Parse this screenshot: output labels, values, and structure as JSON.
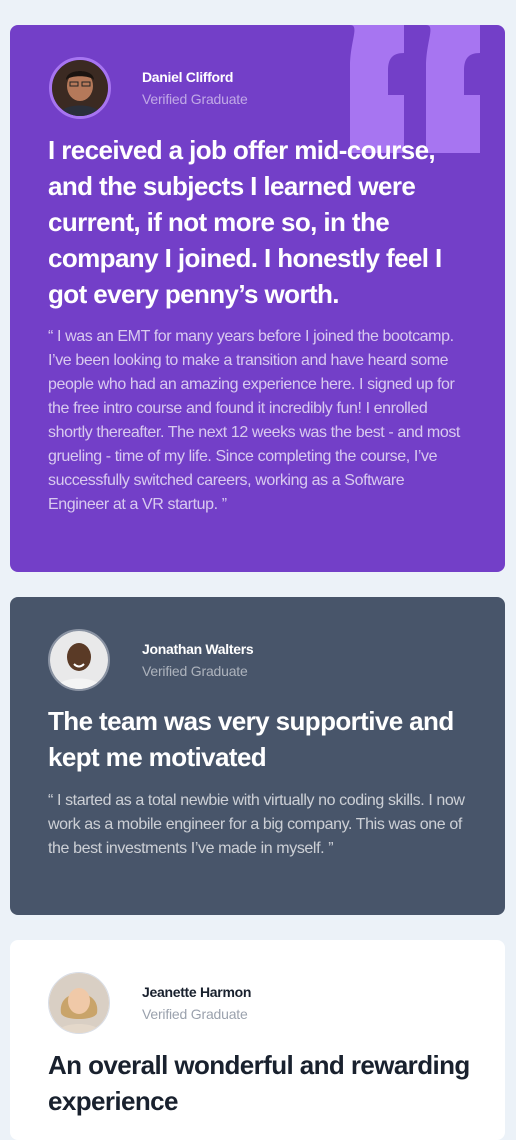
{
  "testimonials": [
    {
      "name": "Daniel Clifford",
      "role": "Verified Graduate",
      "headline": "I received a job offer mid-course, and the subjects I learned were current, if not more so, in the company I joined. I honestly feel I got every penny’s worth.",
      "body": "“ I was an EMT for many years before I joined the bootcamp. I’ve been looking to make a transition and have heard some people who had an amazing experience here. I signed up for the free intro course and found it incredibly fun! I enrolled shortly thereafter. The next 12 weeks was the best - and most grueling - time of my life. Since completing the course, I’ve successfully switched careers, working as a Software Engineer at a VR startup. ”"
    },
    {
      "name": "Jonathan Walters",
      "role": "Verified Graduate",
      "headline": "The team was very supportive and kept me motivated",
      "body": "“ I started as a total newbie with virtually no coding skills. I now work as a mobile engineer for a big company. This was one of the best investments I’ve made in myself. ”"
    },
    {
      "name": "Jeanette Harmon",
      "role": "Verified Graduate",
      "headline": "An overall wonderful and rewarding experience"
    }
  ],
  "colors": {
    "page_bg": "#ecf2f8",
    "purple": "#733fc8",
    "slate": "#48556a",
    "white": "#ffffff",
    "quote_mark": "#a775f1"
  }
}
